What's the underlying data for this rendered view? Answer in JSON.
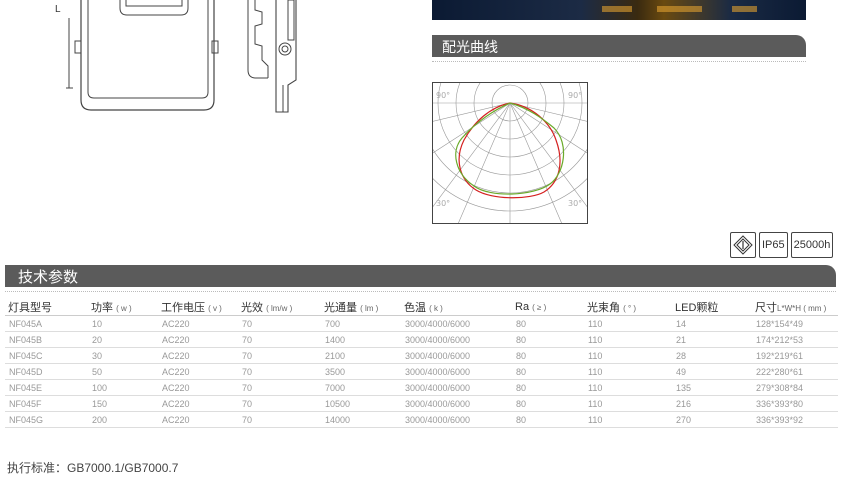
{
  "drawing": {
    "dimension_label": "L"
  },
  "curve_section": {
    "title": "配光曲线"
  },
  "polar_chart": {
    "angle_labels": [
      "90°",
      "90°",
      "30°",
      "30°"
    ]
  },
  "badges": {
    "ip_rating": "IP65",
    "lifetime": "25000h",
    "icon_name": "class-ii-insulation-icon"
  },
  "tech_section": {
    "title": "技术参数"
  },
  "table": {
    "headers": [
      {
        "main": "灯具型号",
        "unit": ""
      },
      {
        "main": "功率",
        "unit": "( w )"
      },
      {
        "main": "工作电压",
        "unit": "( v )"
      },
      {
        "main": "光效",
        "unit": "( lm/w )"
      },
      {
        "main": "光通量",
        "unit": "( lm )"
      },
      {
        "main": "色温",
        "unit": "( k )"
      },
      {
        "main": "Ra",
        "unit": "( ≥ )"
      },
      {
        "main": "光束角",
        "unit": "( ° )"
      },
      {
        "main": "LED颗粒",
        "unit": ""
      },
      {
        "main": "尺寸",
        "unit": "L*W*H ( mm )"
      }
    ],
    "rows": [
      [
        "NF045A",
        "10",
        "AC220",
        "70",
        "700",
        "3000/4000/6000",
        "80",
        "110",
        "14",
        "128*154*49"
      ],
      [
        "NF045B",
        "20",
        "AC220",
        "70",
        "1400",
        "3000/4000/6000",
        "80",
        "110",
        "21",
        "174*212*53"
      ],
      [
        "NF045C",
        "30",
        "AC220",
        "70",
        "2100",
        "3000/4000/6000",
        "80",
        "110",
        "28",
        "192*219*61"
      ],
      [
        "NF045D",
        "50",
        "AC220",
        "70",
        "3500",
        "3000/4000/6000",
        "80",
        "110",
        "49",
        "222*280*61"
      ],
      [
        "NF045E",
        "100",
        "AC220",
        "70",
        "7000",
        "3000/4000/6000",
        "80",
        "110",
        "135",
        "279*308*84"
      ],
      [
        "NF045F",
        "150",
        "AC220",
        "70",
        "10500",
        "3000/4000/6000",
        "80",
        "110",
        "216",
        "336*393*80"
      ],
      [
        "NF045G",
        "200",
        "AC220",
        "70",
        "14000",
        "3000/4000/6000",
        "80",
        "110",
        "270",
        "336*393*92"
      ]
    ]
  },
  "standard": {
    "text": "执行标准：GB7000.1/GB7000.7"
  },
  "colors": {
    "header_bg": "#5b5b5b",
    "curve_red": "#d42020",
    "curve_green": "#6aaa2a"
  }
}
